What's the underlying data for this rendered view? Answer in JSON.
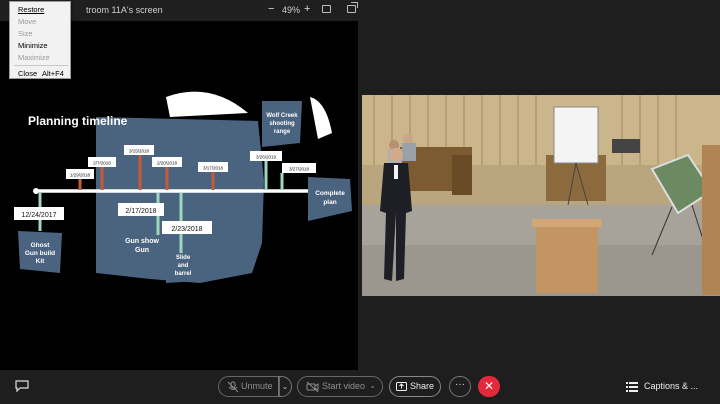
{
  "window": {
    "share_title": "troom 11A's screen",
    "zoom_out": "−",
    "zoom_level": "49%",
    "zoom_in": "+"
  },
  "system_menu": {
    "items": [
      {
        "label": "Restore",
        "enabled": true
      },
      {
        "label": "Move",
        "enabled": false
      },
      {
        "label": "Size",
        "enabled": false
      },
      {
        "label": "Minimize",
        "enabled": true
      },
      {
        "label": "Maximize",
        "enabled": false
      },
      {
        "label": "Close",
        "enabled": true,
        "shortcut": "Alt+F4"
      }
    ]
  },
  "slide": {
    "title": "Planning timeline",
    "events_above": [
      {
        "date": "1/29/2018",
        "color": "#c85a3a"
      },
      {
        "date": "2/7/2018",
        "color": "#c85a3a"
      },
      {
        "date": "3/15/2018",
        "color": "#c85a3a"
      },
      {
        "date": "2/20/2018",
        "color": "#c85a3a"
      },
      {
        "date": "3/17/2018",
        "color": "#c85a3a"
      },
      {
        "date": "3/26/2019",
        "color": "#9fd6c0"
      },
      {
        "date": "3/27/2018",
        "color": "#9fd6c0"
      }
    ],
    "events_below": [
      {
        "date": "12/24/2017",
        "caption": "Ghost Gun build Kit"
      },
      {
        "date": "2/17/2018",
        "caption": "Gun show Gun"
      },
      {
        "date": "2/23/2018",
        "caption": "Slide and barrel"
      }
    ],
    "wolf_creek": "Wolf Creek shooting range",
    "complete": "Complete plan",
    "colors": {
      "panel": "#4a6480",
      "accent_red": "#c85a3a",
      "accent_green": "#9fd6c0",
      "axis": "#ffffff"
    }
  },
  "toolbar": {
    "unmute_label": "Unmute",
    "start_video_label": "Start video",
    "share_label": "Share",
    "more_label": "···",
    "leave_label": "✕",
    "captions_label": "Captions & ..."
  },
  "icons": [
    "chat-icon",
    "mic-muted-icon",
    "camera-off-icon",
    "share-screen-icon",
    "captions-icon",
    "chevron-down-icon",
    "close-icon"
  ]
}
